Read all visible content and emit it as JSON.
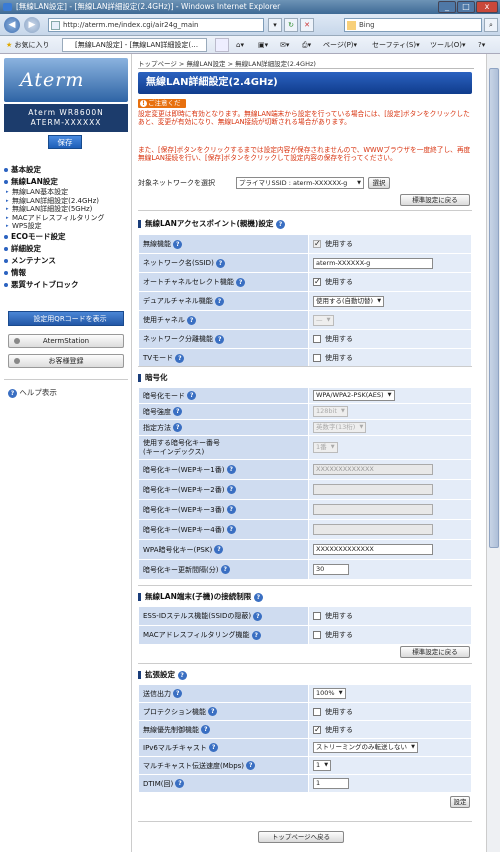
{
  "window": {
    "title": "[無線LAN設定] - [無線LAN詳細設定(2.4GHz)] - Windows Internet Explorer"
  },
  "browser": {
    "url": "http://aterm.me/index.cgi/air24g_main",
    "search_text": "Bing",
    "favorites_label": "お気に入り",
    "tab_label": "[無線LAN設定] - [無線LAN詳細設定(…",
    "cmd_page": "ページ(P)",
    "cmd_safety": "セーフティ(S)",
    "cmd_tools": "ツール(O)",
    "cmd_help": "?"
  },
  "sidebar": {
    "logo": "Aterm",
    "model_line1": "Aterm WR8600N",
    "model_line2": "ATERM-XXXXXX",
    "save": "保存",
    "menu": [
      {
        "label": "基本設定",
        "level": 1
      },
      {
        "label": "無線LAN設定",
        "level": 1
      },
      {
        "label": "無線LAN基本設定",
        "level": 2
      },
      {
        "label": "無線LAN詳細設定(2.4GHz)",
        "level": 2
      },
      {
        "label": "無線LAN詳細設定(5GHz)",
        "level": 2
      },
      {
        "label": "MACアドレスフィルタリング",
        "level": 2
      },
      {
        "label": "WPS設定",
        "level": 2
      },
      {
        "label": "ECOモード設定",
        "level": 1
      },
      {
        "label": "詳細設定",
        "level": 1
      },
      {
        "label": "メンテナンス",
        "level": 1
      },
      {
        "label": "情報",
        "level": 1
      },
      {
        "label": "悪質サイトブロック",
        "level": 1
      }
    ],
    "qr_button": "設定用QRコードを表示",
    "aterm_station": "AtermStation",
    "register": "お客様登録",
    "help": "ヘルプ表示"
  },
  "main": {
    "breadcrumb": "トップページ > 無線LAN設定 > 無線LAN詳細設定(2.4GHz)",
    "title": "無線LAN詳細設定(2.4GHz)",
    "notice_badge": "ご注意ください",
    "warning1": "設定変更は即時に有効となります。無線LAN端末から設定を行っている場合には、[設定]ボタンをクリックしたあと、変更が有効になり、無線LAN接続が切断される場合があります。",
    "warning2": "また、[保存]ボタンをクリックするまでは設定内容が保存されませんので、WWWブラウザを一度終了し、再度無線LAN接続を行い、[保存]ボタンをクリックして設定内容の保存を行ってください。",
    "target_label": "対象ネットワークを選択",
    "target_value": "プライマリSSID : aterm-XXXXXX-g",
    "select_button": "選択",
    "reset_button": "標準設定に戻る",
    "checkbox_label": "使用する",
    "apply_button": "設定",
    "top_button": "トップページへ戻る",
    "sections": {
      "ap": {
        "title": "無線LANアクセスポイント(親機)設定",
        "rows": {
          "wireless": "無線機能",
          "ssid": "ネットワーク名(SSID)",
          "ssid_value": "aterm-XXXXXX-g",
          "auto_ch": "オートチャネルセレクト機能",
          "dual": "デュアルチャネル機能",
          "dual_value": "使用する(自動切替)",
          "channel": "使用チャネル",
          "channel_value": "—",
          "sep": "ネットワーク分離機能",
          "tv": "TVモード"
        }
      },
      "enc": {
        "title": "暗号化",
        "rows": {
          "mode": "暗号化モード",
          "mode_value": "WPA/WPA2-PSK(AES)",
          "strength": "暗号強度",
          "strength_value": "128bit",
          "method": "指定方法",
          "method_value": "英数字(13桁)",
          "keyidx": "使用する暗号化キー番号",
          "keyidx2": "(キーインデックス)",
          "keyidx_value": "1番",
          "wep1": "暗号化キー(WEPキー1番)",
          "wep1_value": "XXXXXXXXXXXXX",
          "wep2": "暗号化キー(WEPキー2番)",
          "wep3": "暗号化キー(WEPキー3番)",
          "wep4": "暗号化キー(WEPキー4番)",
          "psk": "WPA暗号化キー(PSK)",
          "psk_value": "XXXXXXXXXXXXX",
          "interval": "暗号化キー更新間隔(分)",
          "interval_value": "30"
        }
      },
      "client": {
        "title": "無線LAN端末(子機)の接続制限",
        "rows": {
          "stealth": "ESS-IDステルス機能(SSIDの隠蔽)",
          "mac": "MACアドレスフィルタリング機能"
        }
      },
      "ext": {
        "title": "拡張設定",
        "rows": {
          "txpower": "送信出力",
          "txpower_value": "100%",
          "protect": "プロテクション機能",
          "wmm": "無線優先制御機能",
          "ipv6": "IPv6マルチキャスト",
          "ipv6_value": "ストリーミングのみ転送しない",
          "mcast": "マルチキャスト伝送速度(Mbps)",
          "mcast_value": "1",
          "dtim": "DTIM(回)",
          "dtim_value": "1"
        }
      }
    }
  }
}
